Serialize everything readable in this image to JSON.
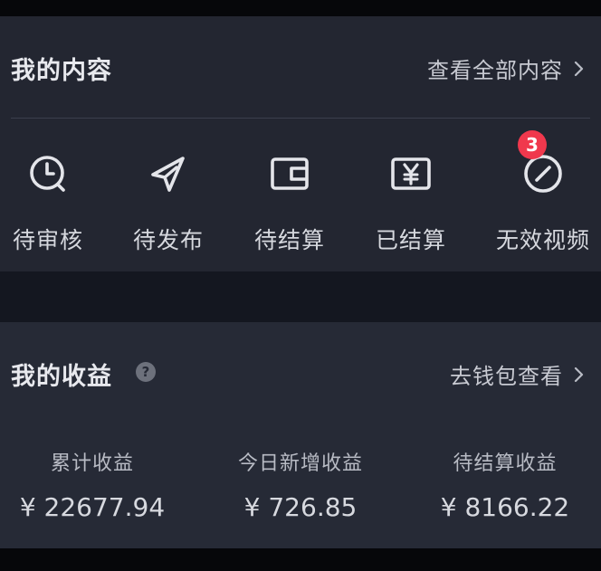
{
  "content_section": {
    "title": "我的内容",
    "view_all_label": "查看全部内容",
    "items": [
      {
        "label": "待审核",
        "icon": "clock-icon"
      },
      {
        "label": "待发布",
        "icon": "paper-plane-icon"
      },
      {
        "label": "待结算",
        "icon": "wallet-icon"
      },
      {
        "label": "已结算",
        "icon": "yen-card-icon"
      },
      {
        "label": "无效视频",
        "icon": "forbidden-icon",
        "badge": "3"
      }
    ]
  },
  "earnings_section": {
    "title": "我的收益",
    "help_glyph": "?",
    "wallet_link_label": "去钱包查看",
    "stats": [
      {
        "label": "累计收益",
        "value": "¥ 22677.94"
      },
      {
        "label": "今日新增收益",
        "value": "¥ 726.85"
      },
      {
        "label": "待结算收益",
        "value": "¥ 8166.22"
      }
    ]
  },
  "colors": {
    "card_background": "#232631",
    "page_background": "#06070a",
    "badge": "#f0384d",
    "text_primary": "#e8e9ee"
  }
}
